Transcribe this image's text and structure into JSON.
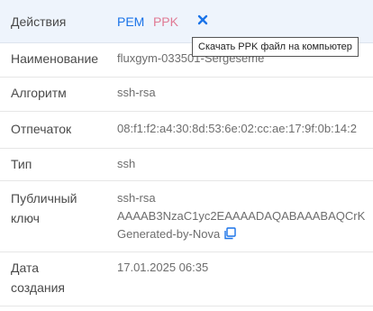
{
  "actions": {
    "label": "Действия",
    "pem_label": "PEM",
    "ppk_label": "PPK",
    "tooltip": "Скачать PPK файл на компьютер"
  },
  "fields": {
    "name": {
      "label": "Наименование",
      "value": "fluxgym-033501-Sergeseme"
    },
    "algorithm": {
      "label": "Алгоритм",
      "value": "ssh-rsa"
    },
    "fingerprint": {
      "label": "Отпечаток",
      "value": "08:f1:f2:a4:30:8d:53:6e:02:cc:ae:17:9f:0b:14:2"
    },
    "type": {
      "label": "Тип",
      "value": "ssh"
    },
    "public_key": {
      "label_line1": "Публичный",
      "label_line2": "ключ",
      "line1": "ssh-rsa",
      "line2": "AAAAB3NzaC1yc2EAAAADAQABAAABAQCrK",
      "line3": "Generated-by-Nova"
    },
    "created": {
      "label_line1": "Дата",
      "label_line2": "создания",
      "value": "17.01.2025 06:35"
    }
  },
  "colors": {
    "pem": "#1a73e8",
    "ppk": "#e07a94",
    "close": "#1a73e8",
    "header_bg": "#eef4fc"
  },
  "icons": {
    "close": "close-icon",
    "copy": "copy-icon"
  }
}
